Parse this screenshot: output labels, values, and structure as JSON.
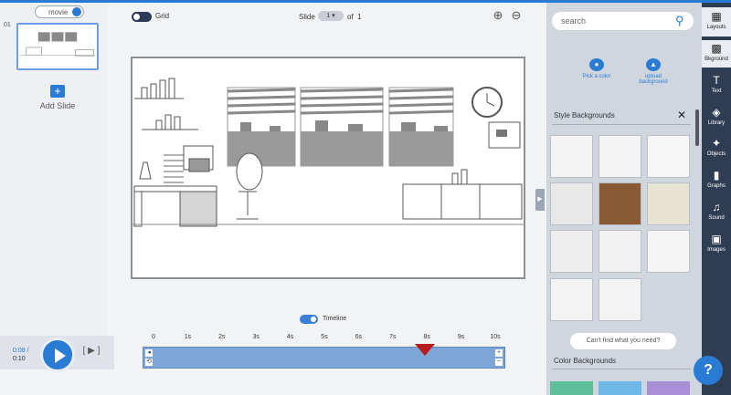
{
  "slides": {
    "mode_label": "movie",
    "slide_number": "01",
    "add_icon": "plus-icon",
    "add_label": "Add Slide"
  },
  "toolbar": {
    "grid_label": "Grid",
    "slide_label": "Slide",
    "slide_value": "1",
    "of_label": "of",
    "slide_total": "1",
    "zoom_in_icon": "zoom-in-icon",
    "zoom_out_icon": "zoom-out-icon"
  },
  "timeline": {
    "toggle_label": "Timeline",
    "time_current": "0:08 /",
    "time_total": "0:10",
    "ticks": [
      "0",
      "1s",
      "2s",
      "3s",
      "4s",
      "5s",
      "6s",
      "7s",
      "8s",
      "9s",
      "10s"
    ],
    "playhead_time_s": 8
  },
  "right_panel": {
    "search_placeholder": "search",
    "pick_color_label": "Pick a color",
    "upload_label": "upload background",
    "style_backgrounds_title": "Style Backgrounds",
    "cant_find_label": "Can't find what you need?",
    "color_backgrounds_title": "Color Backgrounds",
    "color_swatches": [
      "#5fbf9b",
      "#6fb9e6",
      "#a98fd6"
    ]
  },
  "rail": {
    "items": [
      {
        "label": "Layouts",
        "icon": "layouts-icon"
      },
      {
        "label": "Bkground",
        "icon": "background-icon"
      },
      {
        "label": "Text",
        "icon": "text-icon"
      },
      {
        "label": "Library",
        "icon": "library-icon"
      },
      {
        "label": "Objects",
        "icon": "objects-icon"
      },
      {
        "label": "Graphs",
        "icon": "graphs-icon"
      },
      {
        "label": "Sound",
        "icon": "sound-icon"
      },
      {
        "label": "Images",
        "icon": "images-icon"
      }
    ],
    "help_label": "?"
  },
  "colors": {
    "accent": "#2a7bd4",
    "rail_bg": "#2f3d52",
    "timeline_track": "#7da5d8",
    "playhead": "#b71c1c"
  }
}
